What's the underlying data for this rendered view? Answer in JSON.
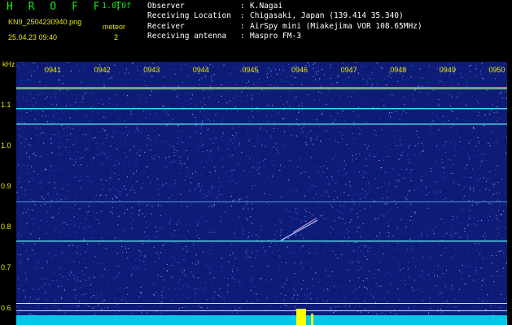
{
  "header": {
    "app_title": "H R O F F T",
    "version": "1.0.0f",
    "filename": "KN9_2504230940.png",
    "mode_label": "meteor",
    "datetime": "25.04.23 09:40",
    "mode_value": "2",
    "info": [
      {
        "key": "Observer",
        "value": "K.Nagai"
      },
      {
        "key": "Receiving Location",
        "value": "Chigasaki, Japan (139.414 35.340)"
      },
      {
        "key": "Receiver",
        "value": "AirSpy mini (Miakejima VOR 108.65MHz)"
      },
      {
        "key": "Receiving antenna",
        "value": "Maspro FM-3"
      }
    ]
  },
  "spectrogram": {
    "unit_label": "kHz",
    "freq_ticks": [
      "1.1",
      "1.0",
      "0.9",
      "0.8",
      "0.7",
      "0.6"
    ],
    "time_ticks": [
      "0941",
      "0942",
      "0943",
      "0944",
      "0945",
      "0946",
      "0947",
      "0948",
      "0949",
      "0950"
    ],
    "colors": {
      "background": "#0e1c78",
      "noise": "#3b5cff",
      "trace": "#4cd6e0",
      "activity": "#ffff00",
      "label": "#e8e800"
    }
  }
}
